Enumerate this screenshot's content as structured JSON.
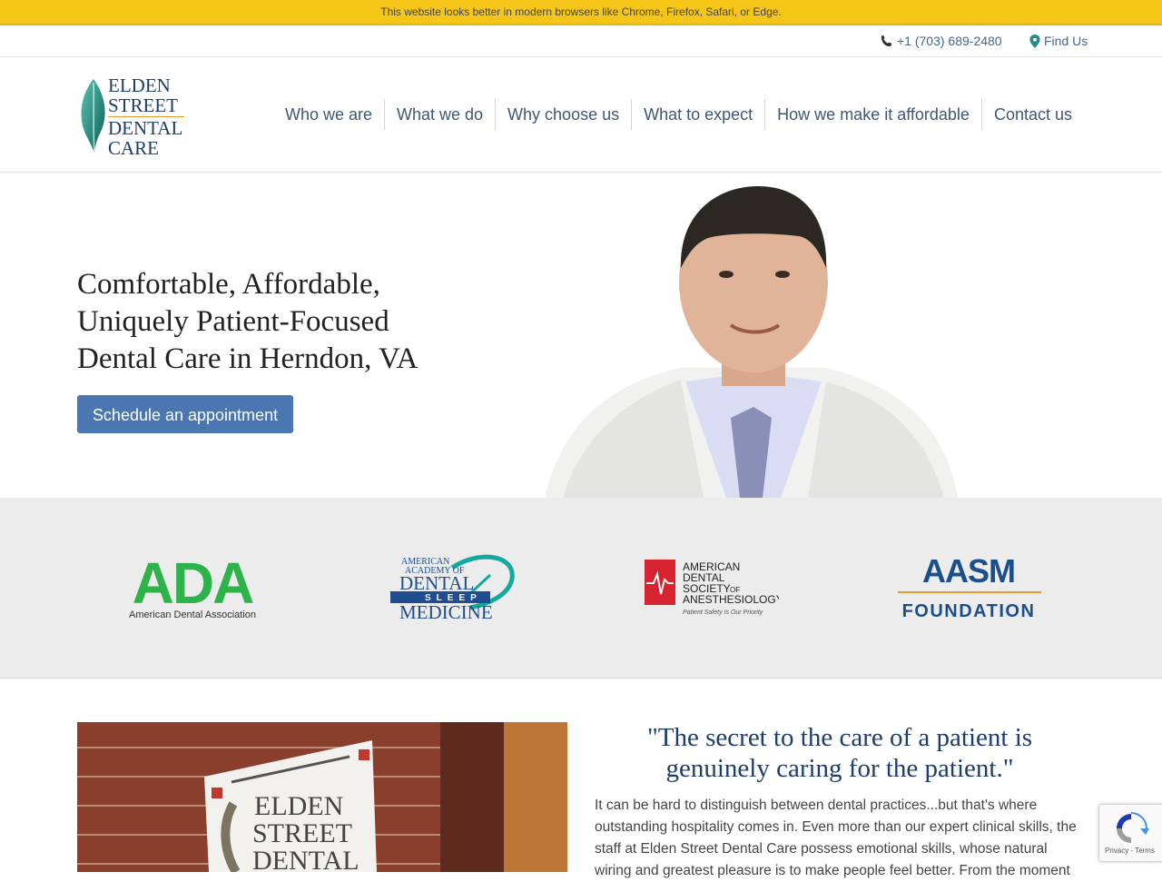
{
  "banner": {
    "text": "This website looks better in modern browsers like Chrome, Firefox, Safari, or Edge."
  },
  "topbar": {
    "phone": "+1 (703) 689-2480",
    "find": "Find Us"
  },
  "brand": {
    "line1": "ELDEN",
    "line2": "STREET",
    "line3": "DENTAL",
    "line4": "CARE"
  },
  "nav": {
    "items": [
      "Who we are",
      "What we do",
      "Why choose us",
      "What to expect",
      "How we make it affordable",
      "Contact us"
    ]
  },
  "hero": {
    "headline_1": "Comfortable, Affordable,",
    "headline_2": "Uniquely Patient-Focused",
    "headline_3": "Dental Care in Herndon, VA",
    "cta": "Schedule an appointment"
  },
  "affiliations": {
    "ada_mark": "ADA",
    "ada_name": "American Dental Association",
    "aadsm_l1": "AMERICAN",
    "aadsm_l2": "ACADEMY OF",
    "aadsm_l3": "DENTAL",
    "aadsm_l4": "SLEEP",
    "aadsm_l5": "MEDICINE",
    "asda_l1": "AMERICAN",
    "asda_l2": "DENTAL",
    "asda_l3": "SOCIETY",
    "asda_of": "OF",
    "asda_l4": "ANESTHESIOLOGY",
    "asda_tag": "Patient Safety Is Our Priority",
    "aasm_mark": "AASM",
    "aasm_foundation": "FOUNDATION"
  },
  "sign": {
    "l1": "ELDEN",
    "l2": "STREET",
    "l3": "DENTAL"
  },
  "about": {
    "quote": "\"The secret to the care of a patient is genuinely caring for the patient.\"",
    "text": "It can be hard to distinguish between dental practices...but that's where outstanding hospitality comes in. Even more than our expert clinical skills, the staff at Elden Street Dental Care possess emotional skills, whose natural wiring and greatest pleasure is to make people feel better. From the moment"
  },
  "recaptcha": {
    "text": "Privacy - Terms"
  },
  "colors": {
    "banner": "#f5c518",
    "nav_text": "#3d5775",
    "cta": "#4a76b1",
    "heading_blue": "#1f3d6b",
    "ada_green": "#2db34a"
  }
}
